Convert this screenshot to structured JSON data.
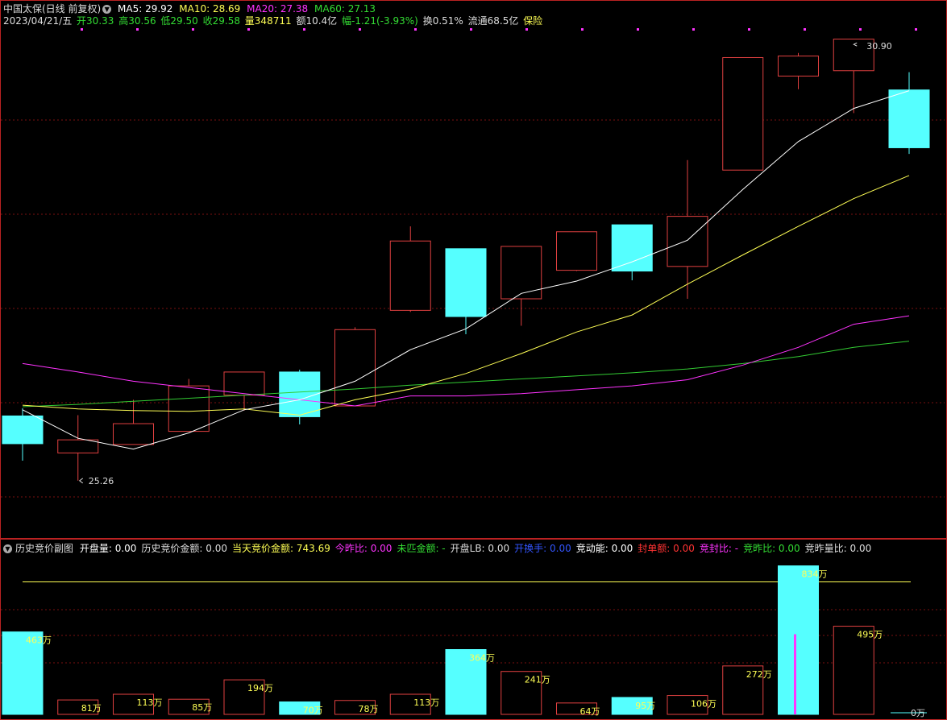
{
  "colors": {
    "up": "#e04040",
    "down": "#55ffff",
    "ma5": "#ffffff",
    "ma10": "#ffff55",
    "ma20": "#ff33ff",
    "ma60": "#33cc33",
    "grid": "#7a1010",
    "frame": "#b22222"
  },
  "header": {
    "stock_title": "中国太保(日线 前复权)",
    "ma5": "MA5: 29.92",
    "ma10": "MA10: 28.69",
    "ma20": "MA20: 27.38",
    "ma60": "MA60: 27.13",
    "date": "2023/04/21/五",
    "open": "开30.33",
    "high": "高30.56",
    "low": "低29.50",
    "close": "收29.58",
    "volume": "量348711",
    "amount": "额10.4亿",
    "change": "幅-1.21(-3.93%)",
    "turnover": "换0.51%",
    "float": "流通68.5亿",
    "sector": "保险"
  },
  "sub_header": {
    "title": "历史竞价副图",
    "items": [
      {
        "text": "开盘量: 0.00",
        "color": "#ffffff"
      },
      {
        "text": "历史竞价金额: 0.00",
        "color": "#dddddd"
      },
      {
        "text": "当天竞价金额: 743.69",
        "color": "#ffff55"
      },
      {
        "text": "今昨比: 0.00",
        "color": "#ff33ff"
      },
      {
        "text": "未匹金额: -",
        "color": "#33dd33"
      },
      {
        "text": "开盘LB: 0.00",
        "color": "#dddddd"
      },
      {
        "text": "开换手: 0.00",
        "color": "#3355ff"
      },
      {
        "text": "竞动能: 0.00",
        "color": "#ffffff"
      },
      {
        "text": "封单额: 0.00",
        "color": "#ff3333"
      },
      {
        "text": "竞封比: -",
        "color": "#ff33ff"
      },
      {
        "text": "竞昨比: 0.00",
        "color": "#33dd33"
      },
      {
        "text": "竞昨量比: 0.00",
        "color": "#dddddd"
      }
    ]
  },
  "chart_data": [
    {
      "type": "candlestick",
      "ylim": [
        24.6,
        31.1
      ],
      "annotations": {
        "high_label": "30.90",
        "low_label": "25.26"
      },
      "candles": [
        {
          "o": 26.1,
          "h": 26.2,
          "c": 25.74,
          "l": 25.52
        },
        {
          "o": 25.62,
          "h": 26.11,
          "c": 25.79,
          "l": 25.26
        },
        {
          "o": 25.73,
          "h": 26.31,
          "c": 26.0,
          "l": 25.73
        },
        {
          "o": 25.9,
          "h": 26.58,
          "c": 26.49,
          "l": 25.9
        },
        {
          "o": 26.37,
          "h": 26.57,
          "c": 26.67,
          "l": 26.17
        },
        {
          "o": 26.67,
          "h": 26.7,
          "c": 26.09,
          "l": 25.99
        },
        {
          "o": 26.23,
          "h": 27.25,
          "c": 27.22,
          "l": 26.23
        },
        {
          "o": 27.47,
          "h": 28.56,
          "c": 28.37,
          "l": 27.45
        },
        {
          "o": 28.27,
          "h": 28.27,
          "c": 27.39,
          "l": 27.16
        },
        {
          "o": 27.62,
          "h": 28.17,
          "c": 28.3,
          "l": 27.27
        },
        {
          "o": 27.99,
          "h": 28.49,
          "c": 28.49,
          "l": 27.98
        },
        {
          "o": 28.58,
          "h": 28.58,
          "c": 27.98,
          "l": 27.86
        },
        {
          "o": 28.04,
          "h": 29.42,
          "c": 28.69,
          "l": 27.62
        },
        {
          "o": 29.29,
          "h": 30.7,
          "c": 30.75,
          "l": 29.29
        },
        {
          "o": 30.51,
          "h": 30.81,
          "c": 30.77,
          "l": 30.34
        },
        {
          "o": 30.58,
          "h": 30.9,
          "c": 30.99,
          "l": 30.03
        },
        {
          "o": 30.33,
          "h": 30.56,
          "c": 29.58,
          "l": 29.5
        }
      ],
      "ma5": [
        26.18,
        25.81,
        25.67,
        25.88,
        26.18,
        26.31,
        26.55,
        26.96,
        27.23,
        27.69,
        27.85,
        28.1,
        28.38,
        29.04,
        29.66,
        30.09,
        30.32
      ],
      "ma10": [
        26.24,
        26.19,
        26.17,
        26.16,
        26.19,
        26.11,
        26.31,
        26.45,
        26.65,
        26.91,
        27.19,
        27.41,
        27.81,
        28.19,
        28.56,
        28.92,
        29.22
      ],
      "ma20": [
        26.78,
        26.67,
        26.55,
        26.47,
        26.39,
        26.31,
        26.23,
        26.36,
        26.36,
        26.39,
        26.44,
        26.49,
        26.57,
        26.76,
        26.99,
        27.29,
        27.4
      ],
      "ma60": [
        26.22,
        26.25,
        26.29,
        26.33,
        26.37,
        26.41,
        26.45,
        26.5,
        26.54,
        26.58,
        26.62,
        26.66,
        26.71,
        26.78,
        26.87,
        26.99,
        27.07
      ]
    },
    {
      "type": "bar",
      "title": "历史竞价副图",
      "ylim": [
        0,
        900
      ],
      "reference_value": 743.69,
      "bottom_label": "0万",
      "values": [
        463,
        81,
        113,
        85,
        194,
        70,
        78,
        113,
        364,
        241,
        64,
        95,
        106,
        272,
        834,
        495
      ],
      "labels": [
        "463万",
        "81万",
        "113万",
        "85万",
        "194万",
        "70万",
        "78万",
        "113万",
        "364万",
        "241万",
        "64万",
        "95万",
        "106万",
        "272万",
        "834万",
        "495万"
      ],
      "filled": [
        true,
        false,
        false,
        false,
        false,
        true,
        false,
        false,
        true,
        false,
        false,
        true,
        false,
        false,
        true,
        false
      ],
      "magenta_marker": {
        "index": 14,
        "value": 450
      }
    }
  ]
}
